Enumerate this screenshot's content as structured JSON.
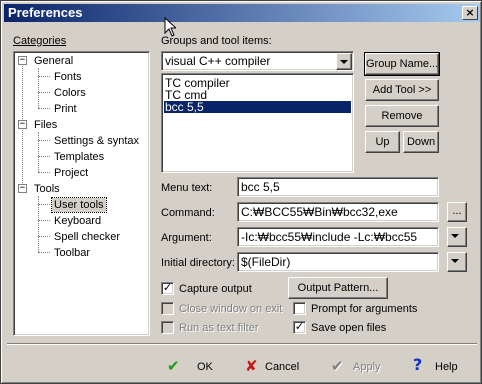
{
  "window": {
    "title": "Preferences",
    "close_glyph": "×"
  },
  "categories": {
    "label": "Categories",
    "items": [
      {
        "label": "General",
        "expander": "−"
      },
      {
        "label": "Fonts"
      },
      {
        "label": "Colors"
      },
      {
        "label": "Print"
      },
      {
        "label": "Files",
        "expander": "−"
      },
      {
        "label": "Settings & syntax"
      },
      {
        "label": "Templates"
      },
      {
        "label": "Project"
      },
      {
        "label": "Tools",
        "expander": "−"
      },
      {
        "label": "User tools",
        "selected": true
      },
      {
        "label": "Keyboard"
      },
      {
        "label": "Spell checker"
      },
      {
        "label": "Toolbar"
      }
    ]
  },
  "groups": {
    "label": "Groups and tool items:",
    "selected_group": "visual C++ compiler",
    "items": [
      {
        "label": "TC compiler"
      },
      {
        "label": "TC cmd"
      },
      {
        "label": "bcc 5,5",
        "selected": true
      }
    ]
  },
  "buttons": {
    "group_name": "Group Name...",
    "add_tool": "Add Tool >>",
    "remove": "Remove",
    "up": "Up",
    "down": "Down",
    "browse": "...",
    "output_pattern": "Output Pattern..."
  },
  "fields": {
    "menu_text_label": "Menu text:",
    "menu_text_value": "bcc 5,5",
    "command_label": "Command:",
    "command_value": "C:₩BCC55₩Bin₩bcc32,exe",
    "argument_label": "Argument:",
    "argument_value": "-Ic:₩bcc55₩include -Lc:₩bcc55",
    "initial_dir_label": "Initial directory:",
    "initial_dir_value": "$(FileDir)"
  },
  "options": {
    "capture_output": {
      "label": "Capture output",
      "checked": true
    },
    "close_window": {
      "label": "Close window on exit",
      "checked": false
    },
    "run_as_filter": {
      "label": "Run as text filter",
      "checked": false
    },
    "prompt_args": {
      "label": "Prompt for arguments",
      "checked": false
    },
    "save_files": {
      "label": "Save open files",
      "checked": true
    }
  },
  "footer": {
    "ok": "OK",
    "cancel": "Cancel",
    "apply": "Apply",
    "help": "Help"
  },
  "colors": {
    "face": "#d4d0c8",
    "title_start": "#0a246a",
    "title_end": "#a6caf0",
    "ok_green": "#1a9a1a",
    "cancel_red": "#c81818",
    "help_blue": "#1030c0"
  }
}
